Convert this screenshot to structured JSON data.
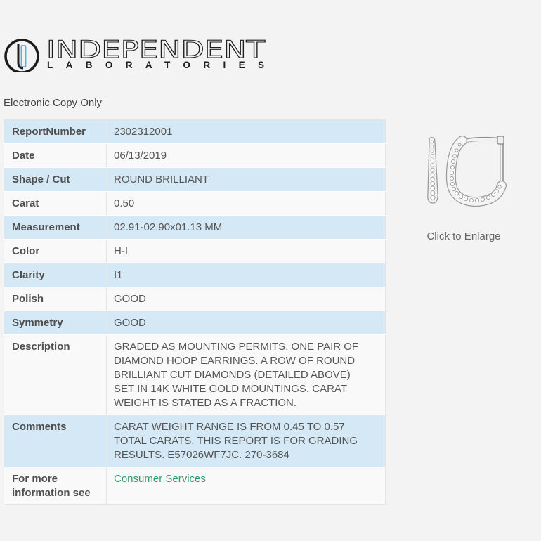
{
  "theme": {
    "page_bg": "#f3f3f3",
    "row_highlight": "#d5e8f5",
    "row_plain": "#f9f9f9",
    "link": "#2a9d6a",
    "logo_accent": "#5aaedc"
  },
  "logo": {
    "name": "INDEPENDENT",
    "subtitle": "LABORATORIES"
  },
  "notice": "Electronic Copy Only",
  "report": {
    "rows": [
      {
        "label": "ReportNumber",
        "value": "2302312001"
      },
      {
        "label": "Date",
        "value": "06/13/2019"
      },
      {
        "label": "Shape / Cut",
        "value": "ROUND BRILLIANT"
      },
      {
        "label": "Carat",
        "value": "0.50"
      },
      {
        "label": "Measurement",
        "value": "02.91-02.90x01.13 MM"
      },
      {
        "label": "Color",
        "value": "H-I"
      },
      {
        "label": "Clarity",
        "value": "I1"
      },
      {
        "label": "Polish",
        "value": "GOOD"
      },
      {
        "label": "Symmetry",
        "value": "GOOD"
      },
      {
        "label": "Description",
        "value": "GRADED AS MOUNTING PERMITS. ONE PAIR OF DIAMOND HOOP EARRINGS. A ROW OF ROUND BRILLIANT CUT DIAMONDS (DETAILED ABOVE) SET IN 14K WHITE GOLD MOUNTINGS. CARAT WEIGHT IS STATED AS A FRACTION."
      },
      {
        "label": "Comments",
        "value": "CARAT WEIGHT RANGE IS FROM 0.45 TO 0.57 TOTAL CARATS. THIS REPORT IS FOR GRADING RESULTS. E57026WF7JC. 270-3684"
      }
    ],
    "more_info": {
      "label": "For more information see",
      "link_text": "Consumer Services"
    }
  },
  "product_image": {
    "caption": "Click to Enlarge"
  }
}
